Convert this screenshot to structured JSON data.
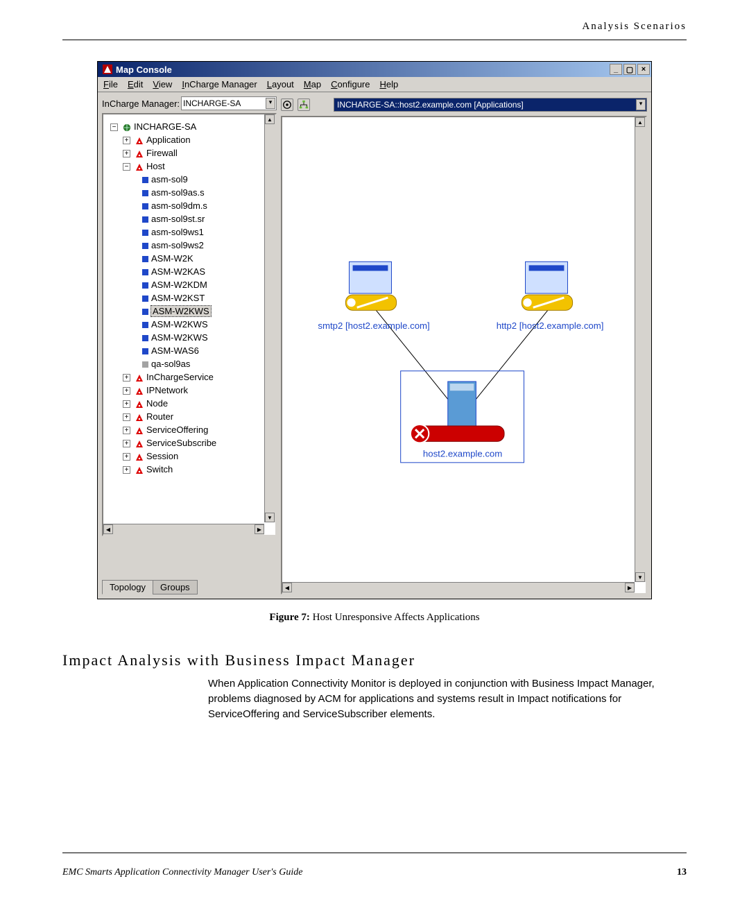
{
  "page_header": "Analysis Scenarios",
  "window": {
    "title": "Map Console",
    "menus": [
      "File",
      "Edit",
      "View",
      "InCharge Manager",
      "Layout",
      "Map",
      "Configure",
      "Help"
    ],
    "left": {
      "label": "InCharge Manager:",
      "dropdown_value": "INCHARGE-SA",
      "tab_active": "Topology",
      "tab_inactive": "Groups"
    },
    "map_selector": "INCHARGE-SA::host2.example.com [Applications]",
    "tree": {
      "root": "INCHARGE-SA",
      "branches_top": [
        "Application",
        "Firewall"
      ],
      "host_label": "Host",
      "host_children": [
        "asm-sol9",
        "asm-sol9as.s",
        "asm-sol9dm.s",
        "asm-sol9st.sr",
        "asm-sol9ws1",
        "asm-sol9ws2",
        "ASM-W2K",
        "ASM-W2KAS",
        "ASM-W2KDM",
        "ASM-W2KST",
        "ASM-W2KWS",
        "ASM-W2KWS",
        "ASM-W2KWS",
        "ASM-WAS6",
        "qa-sol9as"
      ],
      "selected_index": 10,
      "last_greyed": true,
      "branches_bottom": [
        "InChargeService",
        "IPNetwork",
        "Node",
        "Router",
        "ServiceOffering",
        "ServiceSubscribe",
        "Session",
        "Switch"
      ]
    },
    "map": {
      "node_left": "smtp2 [host2.example.com]",
      "node_right": "http2 [host2.example.com]",
      "node_bottom": "host2.example.com"
    }
  },
  "figure": {
    "label": "Figure 7:",
    "caption": "Host Unresponsive Affects Applications"
  },
  "section_heading": "Impact Analysis with Business Impact Manager",
  "section_body": "When Application Connectivity Monitor is deployed in conjunction with Business Impact Manager, problems diagnosed by ACM for applications and systems result in Impact notifications for ServiceOffering and ServiceSubscriber elements.",
  "footer_left": "EMC Smarts Application Connectivity Manager User's Guide",
  "footer_page": "13"
}
